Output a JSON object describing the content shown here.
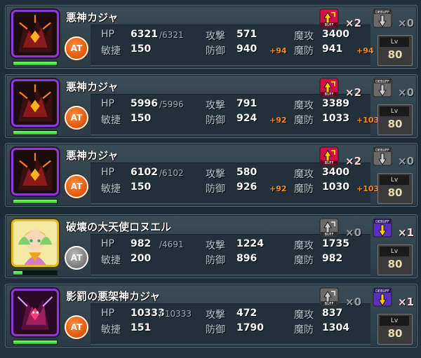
{
  "labels": {
    "hp": "HP",
    "atk": "攻撃",
    "matk": "魔攻",
    "spd": "敏捷",
    "def": "防御",
    "mdef": "魔防",
    "lv": "Lv",
    "at": "AT",
    "buff": "BUFF",
    "debuff": "DEBUFF"
  },
  "colors": {
    "bonus": "#ff8c1a",
    "hp_bar": "#2fbf2f",
    "at_active": "#e0560a",
    "at_inactive": "#7a7a7a"
  },
  "units": [
    {
      "name": "悪神カジャ",
      "portrait": "dark-deity-icon",
      "hp": "6321",
      "hp_max": "/6321",
      "hp_fraction": 1.0,
      "atk": "571",
      "matk": "3400",
      "spd": "150",
      "def": "940",
      "def_bonus": "+94",
      "mdef": "941",
      "mdef_bonus": "+94",
      "at_active": true,
      "buff_count": "×2",
      "buff_active": true,
      "debuff_count": "×0",
      "debuff_active": false,
      "level": "80"
    },
    {
      "name": "悪神カジャ",
      "portrait": "dark-deity-icon",
      "hp": "5996",
      "hp_max": "/5996",
      "hp_fraction": 1.0,
      "atk": "791",
      "matk": "3389",
      "spd": "150",
      "def": "924",
      "def_bonus": "+92",
      "mdef": "1033",
      "mdef_bonus": "+103",
      "at_active": true,
      "buff_count": "×2",
      "buff_active": true,
      "debuff_count": "×0",
      "debuff_active": false,
      "level": "80"
    },
    {
      "name": "悪神カジャ",
      "portrait": "dark-deity-icon",
      "hp": "6102",
      "hp_max": "/6102",
      "hp_fraction": 1.0,
      "atk": "580",
      "matk": "3400",
      "spd": "150",
      "def": "926",
      "def_bonus": "+92",
      "mdef": "1030",
      "mdef_bonus": "+103",
      "at_active": true,
      "buff_count": "×2",
      "buff_active": true,
      "debuff_count": "×0",
      "debuff_active": false,
      "level": "80"
    },
    {
      "name": "破壊の大天使ロヌエル",
      "portrait": "archangel-icon",
      "hp": "982",
      "hp_max": "/4691",
      "hp_fraction": 0.21,
      "atk": "1224",
      "matk": "1735",
      "spd": "200",
      "def": "896",
      "def_bonus": "",
      "mdef": "982",
      "mdef_bonus": "",
      "at_active": false,
      "buff_count": "×0",
      "buff_active": false,
      "debuff_count": "×1",
      "debuff_active": true,
      "level": "80"
    },
    {
      "name": "影罰の悪架神カジャ",
      "portrait": "shadow-deity-icon",
      "hp": "10333",
      "hp_max": "/ 10333",
      "hp_fraction": 1.0,
      "atk": "472",
      "matk": "837",
      "spd": "151",
      "def": "1790",
      "def_bonus": "",
      "mdef": "1304",
      "mdef_bonus": "",
      "at_active": true,
      "buff_count": "×0",
      "buff_active": false,
      "debuff_count": "×1",
      "debuff_active": true,
      "level": "80"
    }
  ]
}
